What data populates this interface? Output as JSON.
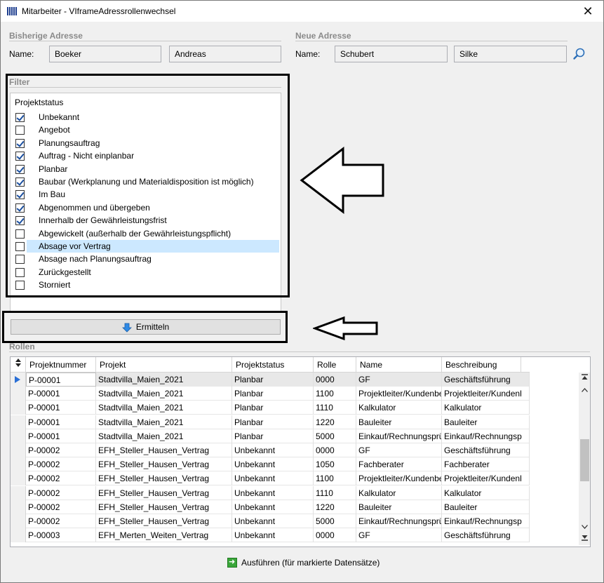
{
  "window": {
    "title": "Mitarbeiter - VIframeAdressrollenwechsel",
    "close_glyph": "✕"
  },
  "bisherige": {
    "title": "Bisherige Adresse",
    "name_label": "Name:",
    "last_name": "Boeker",
    "first_name": "Andreas"
  },
  "neue": {
    "title": "Neue Adresse",
    "name_label": "Name:",
    "last_name": "Schubert",
    "first_name": "Silke"
  },
  "filter": {
    "title": "Filter",
    "group_title": "Projektstatus",
    "items": [
      {
        "label": "Unbekannt",
        "checked": true
      },
      {
        "label": "Angebot",
        "checked": false
      },
      {
        "label": "Planungsauftrag",
        "checked": true
      },
      {
        "label": "Auftrag - Nicht einplanbar",
        "checked": true
      },
      {
        "label": "Planbar",
        "checked": true
      },
      {
        "label": "Baubar (Werkplanung und Materialdisposition ist möglich)",
        "checked": true
      },
      {
        "label": "Im Bau",
        "checked": true
      },
      {
        "label": "Abgenommen und übergeben",
        "checked": true
      },
      {
        "label": "Innerhalb der Gewährleistungsfrist",
        "checked": true
      },
      {
        "label": "Abgewickelt (außerhalb der Gewährleistungspflicht)",
        "checked": false
      },
      {
        "label": "Absage vor Vertrag",
        "checked": false,
        "highlighted": true
      },
      {
        "label": "Absage nach Planungsauftrag",
        "checked": false
      },
      {
        "label": "Zurückgestellt",
        "checked": false
      },
      {
        "label": "Storniert",
        "checked": false
      }
    ]
  },
  "ermitteln_label": "Ermitteln",
  "rollen": {
    "title": "Rollen",
    "columns": [
      "Projektnummer",
      "Projekt",
      "Projektstatus",
      "Rolle",
      "Name",
      "Beschreibung"
    ],
    "rows": [
      [
        "P-00001",
        "Stadtvilla_Maien_2021",
        "Planbar",
        "0000",
        "GF",
        "Geschäftsführung"
      ],
      [
        "P-00001",
        "Stadtvilla_Maien_2021",
        "Planbar",
        "1100",
        "Projektleiter/Kundenbe",
        "Projektleiter/Kundenl"
      ],
      [
        "P-00001",
        "Stadtvilla_Maien_2021",
        "Planbar",
        "1110",
        "Kalkulator",
        "Kalkulator"
      ],
      [
        "P-00001",
        "Stadtvilla_Maien_2021",
        "Planbar",
        "1220",
        "Bauleiter",
        "Bauleiter"
      ],
      [
        "P-00001",
        "Stadtvilla_Maien_2021",
        "Planbar",
        "5000",
        "Einkauf/Rechnungsprü",
        "Einkauf/Rechnungsp"
      ],
      [
        "P-00002",
        "EFH_Steller_Hausen_Vertrag",
        "Unbekannt",
        "0000",
        "GF",
        "Geschäftsführung"
      ],
      [
        "P-00002",
        "EFH_Steller_Hausen_Vertrag",
        "Unbekannt",
        "1050",
        "Fachberater",
        "Fachberater"
      ],
      [
        "P-00002",
        "EFH_Steller_Hausen_Vertrag",
        "Unbekannt",
        "1100",
        "Projektleiter/Kundenbe",
        "Projektleiter/Kundenl"
      ],
      [
        "P-00002",
        "EFH_Steller_Hausen_Vertrag",
        "Unbekannt",
        "1110",
        "Kalkulator",
        "Kalkulator"
      ],
      [
        "P-00002",
        "EFH_Steller_Hausen_Vertrag",
        "Unbekannt",
        "1220",
        "Bauleiter",
        "Bauleiter"
      ],
      [
        "P-00002",
        "EFH_Steller_Hausen_Vertrag",
        "Unbekannt",
        "5000",
        "Einkauf/Rechnungsprü",
        "Einkauf/Rechnungsp"
      ],
      [
        "P-00003",
        "EFH_Merten_Weiten_Vertrag",
        "Unbekannt",
        "0000",
        "GF",
        "Geschäftsführung"
      ]
    ]
  },
  "execute_label": "Ausführen (für markierte Datensätze)"
}
